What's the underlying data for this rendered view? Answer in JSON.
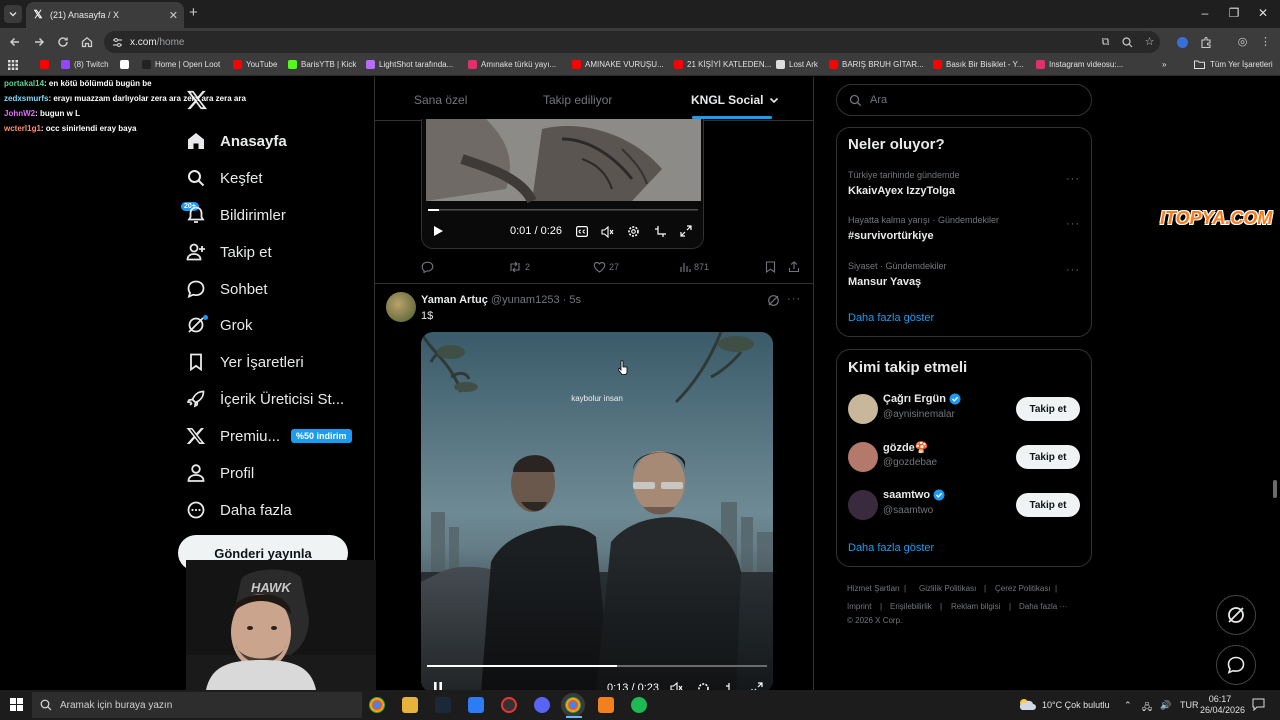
{
  "browser": {
    "tab_title": "(21) Anasayfa / X",
    "url_host": "x.com",
    "url_path": "/home",
    "new_tab_symbol": "+",
    "window_controls": [
      "–",
      "❐",
      "✕"
    ]
  },
  "bookmarks": [
    {
      "label": "",
      "icon": "youtube-icon",
      "color": "#ff0000"
    },
    {
      "label": "(8) Twitch",
      "icon": "twitch-icon",
      "color": "#9146ff"
    },
    {
      "label": "",
      "icon": "google-icon",
      "color": "#ffffff"
    },
    {
      "label": "Home | Open Loot",
      "icon": "openloot-icon",
      "color": "#222222"
    },
    {
      "label": "YouTube",
      "icon": "youtube-icon",
      "color": "#ff0000"
    },
    {
      "label": "BarisYTB | Kick",
      "icon": "kick-icon",
      "color": "#53fc18"
    },
    {
      "label": "LightShot tarafında...",
      "icon": "lightshot-icon",
      "color": "#b56cff"
    },
    {
      "label": "Amınake türkü yayı...",
      "icon": "instagram-icon",
      "color": "#e1306c"
    },
    {
      "label": "AMINAKE VURUŞU...",
      "icon": "youtube-icon",
      "color": "#ff0000"
    },
    {
      "label": "21 KİŞİYİ KATLEDEN...",
      "icon": "youtube-icon",
      "color": "#ff0000"
    },
    {
      "label": "Lost Ark",
      "icon": "globe-icon",
      "color": "#dddddd"
    },
    {
      "label": "BARIŞ BRUH GİTAR...",
      "icon": "youtube-icon",
      "color": "#ff0000"
    },
    {
      "label": "Basık Bir Bisiklet - Y...",
      "icon": "youtube-icon",
      "color": "#ff0000"
    },
    {
      "label": "Instagram videosu:...",
      "icon": "instagram-icon",
      "color": "#e1306c"
    }
  ],
  "bookmarks_more": "»",
  "all_bookmarks": "Tüm Yer İşaretleri",
  "chat_overlay": [
    {
      "user": "portakal14",
      "message": ": en kötü bölümdü bugün be",
      "cls": "u1"
    },
    {
      "user": "zedxsmurfs",
      "message": ": erayı muazzam darlıyolar zera ara zera ara zera ara",
      "cls": "u2"
    },
    {
      "user": "JohnW2",
      "message": ": bugun w L",
      "cls": "u3"
    },
    {
      "user": "wcterl1g1",
      "message": ": occ sinirlendi eray baya",
      "cls": "u4"
    }
  ],
  "sidebar": {
    "logo": "X",
    "items": [
      {
        "label": "Anasayfa",
        "icon": "home-icon",
        "bold": true
      },
      {
        "label": "Keşfet",
        "icon": "search-icon"
      },
      {
        "label": "Bildirimler",
        "icon": "bell-icon"
      },
      {
        "label": "Takip et",
        "icon": "add-user-icon"
      },
      {
        "label": "Sohbet",
        "icon": "chat-icon"
      },
      {
        "label": "Grok",
        "icon": "grok-icon"
      },
      {
        "label": "Yer İşaretleri",
        "icon": "bookmark-icon"
      },
      {
        "label": "İçerik Üreticisi St...",
        "icon": "rocket-icon"
      },
      {
        "label": "Premiu...",
        "icon": "x-icon"
      },
      {
        "label": "Profil",
        "icon": "profile-icon"
      },
      {
        "label": "Daha fazla",
        "icon": "more-icon"
      }
    ],
    "notification_badge": "20+",
    "premium_tag": "%50 indirim",
    "post_button": "Gönderi yayınla"
  },
  "feed": {
    "tabs": [
      "Sana özel",
      "Takip ediliyor",
      "KNGL Social"
    ],
    "active_tab": "KNGL Social",
    "top_video": {
      "time": "0:01 / 0:26",
      "progress": 0.04
    },
    "top_actions": {
      "retweets": "2",
      "likes": "27",
      "views": "871"
    },
    "tweet": {
      "author": "Yaman Artuç",
      "handle": "@yunam1253",
      "time": "· 5s",
      "text": "1$",
      "video_caption": "kaybolur insan",
      "video_time": "0:13 / 0:23",
      "progress": 0.56
    }
  },
  "right": {
    "search_placeholder": "Ara",
    "trends_title": "Neler oluyor?",
    "trends": [
      {
        "context": "Türkiye tarihinde gündemde",
        "name": "KkaivAyex IzzyTolga"
      },
      {
        "context": "Hayatta kalma yarışı · Gündemdekiler",
        "name": "#survivortürkiye"
      },
      {
        "context": "Siyaset · Gündemdekiler",
        "name": "Mansur Yavaş"
      }
    ],
    "show_more": "Daha fazla göster",
    "who_title": "Kimi takip etmeli",
    "who": [
      {
        "name": "Çağrı Ergün",
        "handle": "@aynisinemalar",
        "verified": true,
        "avatar_color": "#c9b79c"
      },
      {
        "name": "gözde🍄",
        "handle": "@gozdebae",
        "verified": false,
        "avatar_color": "#b37a6b"
      },
      {
        "name": "saamtwo",
        "handle": "@saamtwo",
        "verified": true,
        "avatar_color": "#3a2a3e"
      }
    ],
    "follow_label": "Takip et",
    "footer": {
      "row1": [
        "Hizmet Şartları",
        "|",
        "Gizlilik Politikası",
        "|",
        "Çerez Politikası",
        "|"
      ],
      "row2": [
        "Imprint",
        "|",
        "Erişilebilirlik",
        "|",
        "Reklam bilgisi",
        "|",
        "Daha fazla ···"
      ],
      "copyright": "© 2026 X Corp."
    }
  },
  "overlay_logo": "ITOPYA.COM",
  "webcam_logo": "HAWK",
  "taskbar": {
    "search_placeholder": "Aramak için buraya yazın",
    "weather": "10°C  Çok bulutlu",
    "lang": "TUR",
    "time": "06:17",
    "date": "26/04/2026"
  }
}
